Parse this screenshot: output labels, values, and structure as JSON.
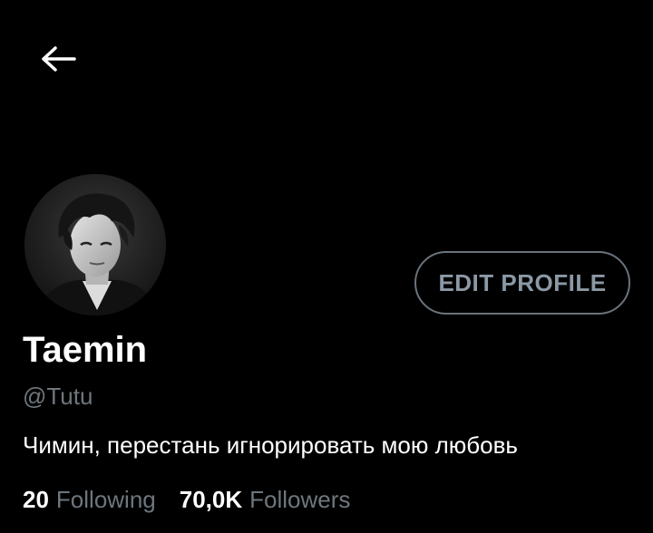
{
  "header": {
    "back_icon": "arrow-left-icon"
  },
  "profile": {
    "avatar_icon": "profile-photo",
    "display_name": "Taemin",
    "handle": "@Tutu",
    "bio": "Чимин, перестань игнорировать мою любовь",
    "edit_button_label": "EDIT PROFILE"
  },
  "stats": {
    "following_count": "20",
    "following_label": "Following",
    "followers_count": "70,0K",
    "followers_label": "Followers"
  },
  "colors": {
    "background": "#000000",
    "primary_text": "#ffffff",
    "secondary_text": "#6e767d",
    "button_border": "#6a737c",
    "button_text": "#8b98a5"
  }
}
